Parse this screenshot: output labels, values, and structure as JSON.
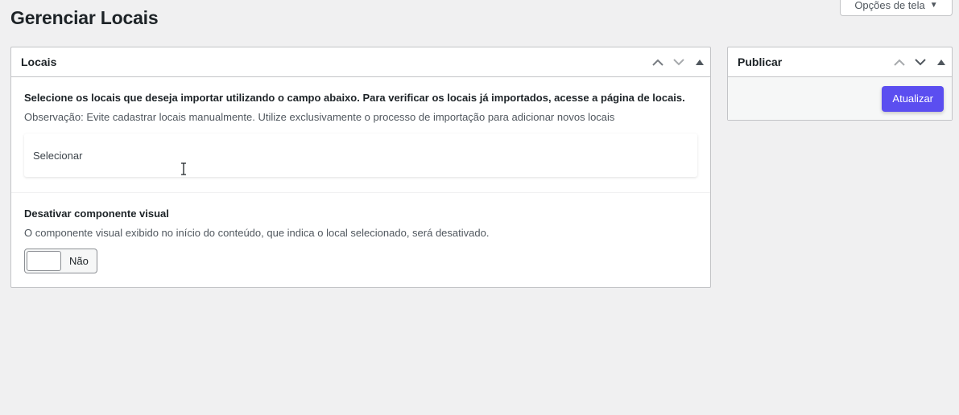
{
  "screen_options": {
    "label": "Opções de tela"
  },
  "page": {
    "title": "Gerenciar Locais"
  },
  "locais_box": {
    "title": "Locais",
    "description": "Selecione os locais que deseja importar utilizando o campo abaixo. Para verificar os locais já importados, acesse a página de locais.",
    "note": "Observação: Evite cadastrar locais manualmente. Utilize exclusivamente o processo de importação para adicionar novos locais",
    "select_placeholder": "Selecionar",
    "visual_component": {
      "label": "Desativar componente visual",
      "description": "O componente visual exibido no início do conteúdo, que indica o local selecionado, será desativado.",
      "toggle_label": "Não",
      "toggle_on": false
    }
  },
  "publish_box": {
    "title": "Publicar",
    "update_label": "Atualizar"
  },
  "colors": {
    "primary_button": "#5b4ef0",
    "background": "#f0f0f1"
  }
}
